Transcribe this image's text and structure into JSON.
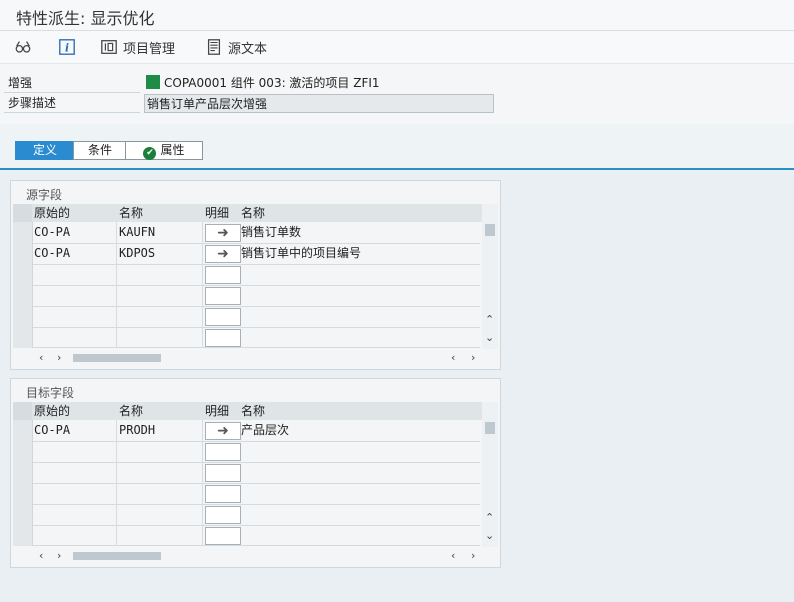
{
  "window": {
    "title": "特性派生: 显示优化"
  },
  "toolbar": {
    "items": [
      {
        "icon": "glasses-icon",
        "label": ""
      },
      {
        "icon": "info-icon",
        "label": ""
      },
      {
        "icon": "project-icon",
        "label": "项目管理"
      },
      {
        "icon": "document-icon",
        "label": "源文本"
      }
    ]
  },
  "form": {
    "enhancement_label": "增强",
    "enhancement_value": "COPA0001 组件 003: 激活的项目 ZFI1",
    "step_label": "步骤描述",
    "step_value": "销售订单产品层次增强"
  },
  "tabs": [
    {
      "label": "定义",
      "active": true
    },
    {
      "label": "条件",
      "active": false
    },
    {
      "label": "属性",
      "active": false
    }
  ],
  "source_group": {
    "title": "源字段",
    "columns": [
      "原始的",
      "名称",
      "明细",
      "名称"
    ],
    "rows": [
      {
        "origin": "CO-PA",
        "name": "KAUFN",
        "detail": "➜",
        "desc": "销售订单数"
      },
      {
        "origin": "CO-PA",
        "name": "KDPOS",
        "detail": "➜",
        "desc": "销售订单中的项目编号"
      }
    ]
  },
  "target_group": {
    "title": "目标字段",
    "columns": [
      "原始的",
      "名称",
      "明细",
      "名称"
    ],
    "rows": [
      {
        "origin": "CO-PA",
        "name": "PRODH",
        "detail": "➜",
        "desc": "产品层次"
      }
    ]
  },
  "scroll": {
    "left": "‹",
    "right": "›",
    "up": "⌃",
    "down": "⌄"
  },
  "colors": {
    "accent": "#2a8bd1",
    "green": "#1e8c47"
  }
}
